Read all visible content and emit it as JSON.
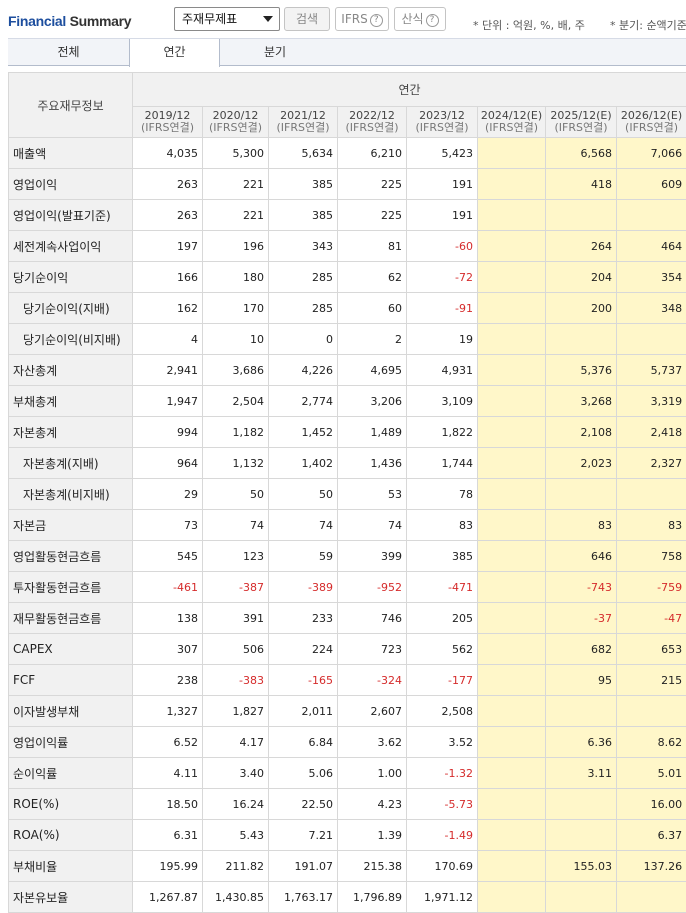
{
  "header": {
    "title_part1": "Financial",
    "title_part2": "Summary",
    "statement_select": "주재무제표",
    "search_button": "검색",
    "ifrs_button": "IFRS",
    "calc_button": "산식",
    "help_glyph": "?",
    "unit_note": "* 단위 : 억원, %, 배, 주",
    "period_note": "* 분기: 순액기준"
  },
  "tabs": [
    "전체",
    "연간",
    "분기"
  ],
  "table": {
    "corner_label": "주요재무정보",
    "group_label": "연간",
    "columns": [
      {
        "year": "2019/12",
        "sub": "(IFRS연결)",
        "estimate": false
      },
      {
        "year": "2020/12",
        "sub": "(IFRS연결)",
        "estimate": false
      },
      {
        "year": "2021/12",
        "sub": "(IFRS연결)",
        "estimate": false
      },
      {
        "year": "2022/12",
        "sub": "(IFRS연결)",
        "estimate": false
      },
      {
        "year": "2023/12",
        "sub": "(IFRS연결)",
        "estimate": false
      },
      {
        "year": "2024/12(E)",
        "sub": "(IFRS연결)",
        "estimate": true
      },
      {
        "year": "2025/12(E)",
        "sub": "(IFRS연결)",
        "estimate": true
      },
      {
        "year": "2026/12(E)",
        "sub": "(IFRS연결)",
        "estimate": true
      }
    ],
    "rows": [
      {
        "label": "매출액",
        "sub": false,
        "values": [
          "4,035",
          "5,300",
          "5,634",
          "6,210",
          "5,423",
          "",
          "6,568",
          "7,066"
        ]
      },
      {
        "label": "영업이익",
        "sub": false,
        "values": [
          "263",
          "221",
          "385",
          "225",
          "191",
          "",
          "418",
          "609"
        ]
      },
      {
        "label": "영업이익(발표기준)",
        "sub": false,
        "values": [
          "263",
          "221",
          "385",
          "225",
          "191",
          "",
          "",
          ""
        ]
      },
      {
        "label": "세전계속사업이익",
        "sub": false,
        "values": [
          "197",
          "196",
          "343",
          "81",
          "-60",
          "",
          "264",
          "464"
        ]
      },
      {
        "label": "당기순이익",
        "sub": false,
        "values": [
          "166",
          "180",
          "285",
          "62",
          "-72",
          "",
          "204",
          "354"
        ]
      },
      {
        "label": "당기순이익(지배)",
        "sub": true,
        "values": [
          "162",
          "170",
          "285",
          "60",
          "-91",
          "",
          "200",
          "348"
        ]
      },
      {
        "label": "당기순이익(비지배)",
        "sub": true,
        "values": [
          "4",
          "10",
          "0",
          "2",
          "19",
          "",
          "",
          ""
        ]
      },
      {
        "label": "자산총계",
        "sub": false,
        "values": [
          "2,941",
          "3,686",
          "4,226",
          "4,695",
          "4,931",
          "",
          "5,376",
          "5,737"
        ]
      },
      {
        "label": "부채총계",
        "sub": false,
        "values": [
          "1,947",
          "2,504",
          "2,774",
          "3,206",
          "3,109",
          "",
          "3,268",
          "3,319"
        ]
      },
      {
        "label": "자본총계",
        "sub": false,
        "values": [
          "994",
          "1,182",
          "1,452",
          "1,489",
          "1,822",
          "",
          "2,108",
          "2,418"
        ]
      },
      {
        "label": "자본총계(지배)",
        "sub": true,
        "values": [
          "964",
          "1,132",
          "1,402",
          "1,436",
          "1,744",
          "",
          "2,023",
          "2,327"
        ]
      },
      {
        "label": "자본총계(비지배)",
        "sub": true,
        "values": [
          "29",
          "50",
          "50",
          "53",
          "78",
          "",
          "",
          ""
        ]
      },
      {
        "label": "자본금",
        "sub": false,
        "values": [
          "73",
          "74",
          "74",
          "74",
          "83",
          "",
          "83",
          "83"
        ]
      },
      {
        "label": "영업활동현금흐름",
        "sub": false,
        "values": [
          "545",
          "123",
          "59",
          "399",
          "385",
          "",
          "646",
          "758"
        ]
      },
      {
        "label": "투자활동현금흐름",
        "sub": false,
        "values": [
          "-461",
          "-387",
          "-389",
          "-952",
          "-471",
          "",
          "-743",
          "-759"
        ]
      },
      {
        "label": "재무활동현금흐름",
        "sub": false,
        "values": [
          "138",
          "391",
          "233",
          "746",
          "205",
          "",
          "-37",
          "-47"
        ]
      },
      {
        "label": "CAPEX",
        "sub": false,
        "values": [
          "307",
          "506",
          "224",
          "723",
          "562",
          "",
          "682",
          "653"
        ]
      },
      {
        "label": "FCF",
        "sub": false,
        "values": [
          "238",
          "-383",
          "-165",
          "-324",
          "-177",
          "",
          "95",
          "215"
        ]
      },
      {
        "label": "이자발생부채",
        "sub": false,
        "values": [
          "1,327",
          "1,827",
          "2,011",
          "2,607",
          "2,508",
          "",
          "",
          ""
        ]
      },
      {
        "label": "영업이익률",
        "sub": false,
        "values": [
          "6.52",
          "4.17",
          "6.84",
          "3.62",
          "3.52",
          "",
          "6.36",
          "8.62"
        ]
      },
      {
        "label": "순이익률",
        "sub": false,
        "values": [
          "4.11",
          "3.40",
          "5.06",
          "1.00",
          "-1.32",
          "",
          "3.11",
          "5.01"
        ]
      },
      {
        "label": "ROE(%)",
        "sub": false,
        "values": [
          "18.50",
          "16.24",
          "22.50",
          "4.23",
          "-5.73",
          "",
          "",
          "16.00"
        ]
      },
      {
        "label": "ROA(%)",
        "sub": false,
        "values": [
          "6.31",
          "5.43",
          "7.21",
          "1.39",
          "-1.49",
          "",
          "",
          "6.37"
        ]
      },
      {
        "label": "부채비율",
        "sub": false,
        "values": [
          "195.99",
          "211.82",
          "191.07",
          "215.38",
          "170.69",
          "",
          "155.03",
          "137.26"
        ]
      },
      {
        "label": "자본유보율",
        "sub": false,
        "values": [
          "1,267.87",
          "1,430.85",
          "1,763.17",
          "1,796.89",
          "1,971.12",
          "",
          "",
          ""
        ]
      }
    ]
  },
  "colors": {
    "brand_blue": "#1d4e9e",
    "negative_red": "#d52b2b",
    "estimate_bg": "#fff7c9",
    "label_bg": "#f1f1f1"
  }
}
